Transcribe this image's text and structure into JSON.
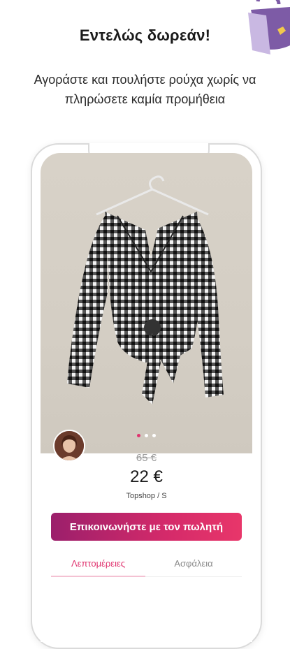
{
  "headline": "Εντελώς δωρεάν!",
  "subtitle": "Αγοράστε και πουλήστε ρούχα χωρίς να πληρώσετε καμία προμήθεια",
  "product": {
    "old_price": "65 €",
    "price": "22 €",
    "brand_size": "Topshop / S",
    "image_count": 3,
    "active_image": 1
  },
  "actions": {
    "contact_label": "Επικοινωνήστε με τον πωλητή"
  },
  "tabs": [
    {
      "label": "Λεπτομέρειες",
      "active": true
    },
    {
      "label": "Ασφάλεια",
      "active": false
    }
  ],
  "colors": {
    "accent": "#e0336f",
    "button_start": "#9b1f6b",
    "button_end": "#e8366a",
    "decor": "#7d5ba6"
  },
  "icons": {
    "decor": "purse-icon",
    "avatar": "seller-avatar"
  }
}
